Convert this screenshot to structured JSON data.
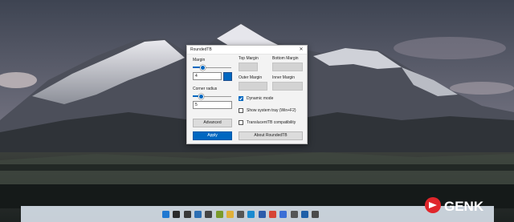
{
  "window": {
    "title": "RoundedTB",
    "close_glyph": "✕"
  },
  "left": {
    "margin_label": "Margin",
    "margin_slider_fraction": 0.25,
    "margin_value": "4",
    "corner_label": "Corner radius",
    "corner_slider_fraction": 0.2,
    "corner_value": "5",
    "advanced_label": "Advanced",
    "apply_label": "Apply"
  },
  "right": {
    "top_margin_label": "Top Margin",
    "bottom_margin_label": "Bottom Margin",
    "outer_margin_label": "Outer Margin",
    "inner_margin_label": "Inner Margin",
    "options": [
      {
        "label": "Dynamic mode",
        "checked": true
      },
      {
        "label": "Show system tray (Win+F2)",
        "checked": false
      },
      {
        "label": "TranslucentTB compatibility",
        "checked": false
      }
    ],
    "about_label": "About RoundedTB"
  },
  "taskbar": {
    "icons": [
      {
        "name": "start-icon",
        "color": "#1f78d1"
      },
      {
        "name": "search-icon",
        "color": "#2b2b2b"
      },
      {
        "name": "task-view-icon",
        "color": "#3a3a3a"
      },
      {
        "name": "app-icon",
        "color": "#2d6fb3"
      },
      {
        "name": "app-icon",
        "color": "#444444"
      },
      {
        "name": "app-icon",
        "color": "#7a9a2b"
      },
      {
        "name": "file-explorer-icon",
        "color": "#e0b03a"
      },
      {
        "name": "search-app-icon",
        "color": "#555555"
      },
      {
        "name": "edge-icon",
        "color": "#1a8bd1"
      },
      {
        "name": "word-icon",
        "color": "#2b5cab"
      },
      {
        "name": "chrome-icon",
        "color": "#d64535"
      },
      {
        "name": "app-icon",
        "color": "#3b6fd6"
      },
      {
        "name": "app-icon",
        "color": "#555555"
      },
      {
        "name": "app-icon",
        "color": "#1f5fa8"
      },
      {
        "name": "settings-icon",
        "color": "#4a4a4a"
      }
    ]
  },
  "watermark": {
    "text": "GENK"
  }
}
